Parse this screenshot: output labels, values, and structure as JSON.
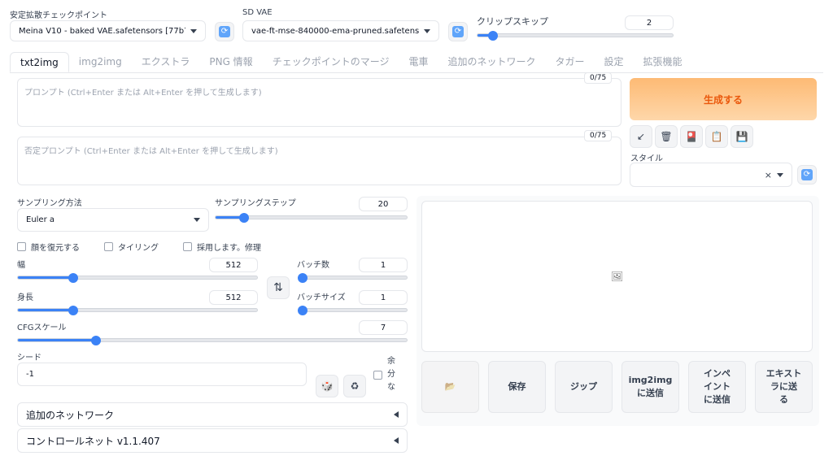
{
  "top": {
    "checkpoint_label": "安定拡散チェックポイント",
    "checkpoint_value": "Meina V10 - baked VAE.safetensors [77b7dc4ef0",
    "vae_label": "SD VAE",
    "vae_value": "vae-ft-mse-840000-ema-pruned.safetensors",
    "clip_label": "クリップスキップ",
    "clip_value": "2",
    "clip_fraction": 0.08,
    "refresh_glyph": "⟳"
  },
  "tabs": [
    "txt2img",
    "img2img",
    "エクストラ",
    "PNG 情報",
    "チェックポイントのマージ",
    "電車",
    "追加のネットワーク",
    "タガー",
    "設定",
    "拡張機能"
  ],
  "prompt": {
    "placeholder": "プロンプト (Ctrl+Enter または Alt+Enter を押して生成します)",
    "counter": "0/75",
    "neg_placeholder": "否定プロンプト (Ctrl+Enter または Alt+Enter を押して生成します)",
    "neg_counter": "0/75"
  },
  "generate": {
    "label": "生成する",
    "color_top": "#fdba74",
    "color_text": "#ea580c"
  },
  "tool_buttons": [
    {
      "icon": "arrow-icon",
      "glyph": "↙"
    },
    {
      "icon": "trash-icon",
      "glyph": "🗑"
    },
    {
      "icon": "red-card-icon",
      "glyph": "🎴"
    },
    {
      "icon": "clipboard-icon",
      "glyph": "📋"
    },
    {
      "icon": "save-icon",
      "glyph": "💾"
    }
  ],
  "style": {
    "label": "スタイル",
    "clear_glyph": "×"
  },
  "sampling": {
    "method_label": "サンプリング方法",
    "method_value": "Euler a",
    "steps_label": "サンプリングステップ",
    "steps_value": "20",
    "steps_fraction": 0.15
  },
  "checkboxes": [
    "顔を復元する",
    "タイリング",
    "採用します。修理"
  ],
  "width": {
    "label": "幅",
    "value": "512",
    "fraction": 0.23
  },
  "height": {
    "label": "身長",
    "value": "512",
    "fraction": 0.23
  },
  "swap_glyph": "⇅",
  "batch_count": {
    "label": "バッチ数",
    "value": "1",
    "fraction": 0.0
  },
  "batch_size": {
    "label": "バッチサイズ",
    "value": "1",
    "fraction": 0.0
  },
  "cfg": {
    "label": "CFGスケール",
    "value": "7",
    "fraction": 0.2
  },
  "seed": {
    "label": "シード",
    "value": "-1",
    "dice_glyph": "🎲",
    "recycle_glyph": "♻",
    "extra_label": [
      "余",
      "分",
      "な"
    ]
  },
  "accordions": [
    {
      "label": "追加のネットワーク"
    },
    {
      "label": "コントロールネット v1.1.407"
    }
  ],
  "output": {
    "image_icon_glyph": "🖼",
    "buttons": {
      "folder_glyph": "📂",
      "save": "保存",
      "zip": "ジップ",
      "img2img": [
        "img2img",
        "に送信"
      ],
      "inpaint": [
        "インペ",
        "イント",
        "に送信"
      ],
      "extras": [
        "エキスト",
        "ラに送",
        "る"
      ]
    }
  }
}
